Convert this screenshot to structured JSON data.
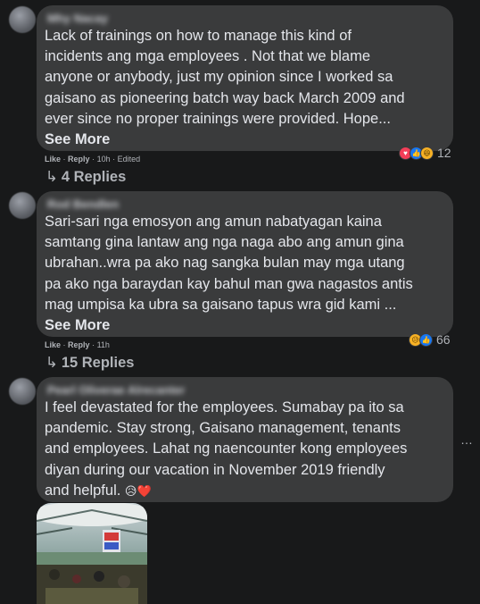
{
  "comments": [
    {
      "author": "Mhy Nacay",
      "text": "Lack of trainings on how to manage this kind of\nincidents ang mga employees . Not that we blame\nanyone or anybody, just my opinion since I worked sa\ngaisano as pioneering batch way back March 2009 and\never since no proper trainings were provided. Hope...",
      "see_more": "See More",
      "like": "Like",
      "reply": "Reply",
      "time": "10h",
      "edited": "Edited",
      "reaction_count": "12",
      "replies_label": "4 Replies"
    },
    {
      "author": "Rod Bendlen",
      "text": "Sari-sari nga emosyon ang amun nabatyagan kaina\nsamtang gina lantaw ang nga naga abo ang amun gina\nubrahan..wra pa ako nag sangka bulan may mga utang\npa ako nga baraydan kay bahul man gwa nagastos antis\nmag umpisa ka ubra sa gaisano tapus wra gid kami ...",
      "see_more": "See More",
      "like": "Like",
      "reply": "Reply",
      "time": "11h",
      "reaction_count": "66",
      "replies_label": "15 Replies"
    },
    {
      "author": "Pearl Oliverae Alrecanter",
      "text": "I feel devastated for the employees. Sumabay pa ito sa\npandemic. Stay strong, Gaisano management, tenants\nand employees. Lahat ng naencounter kong employees\ndiyan during our vacation in November 2019 friendly\nand helpful.",
      "text_emoji": "😥❤️",
      "more_icon": "…"
    }
  ],
  "meta_separator": "·",
  "icons": {
    "reply_arrow": "↳",
    "love": "♥",
    "like": "👍",
    "haha": "😆",
    "sad": "😥"
  }
}
